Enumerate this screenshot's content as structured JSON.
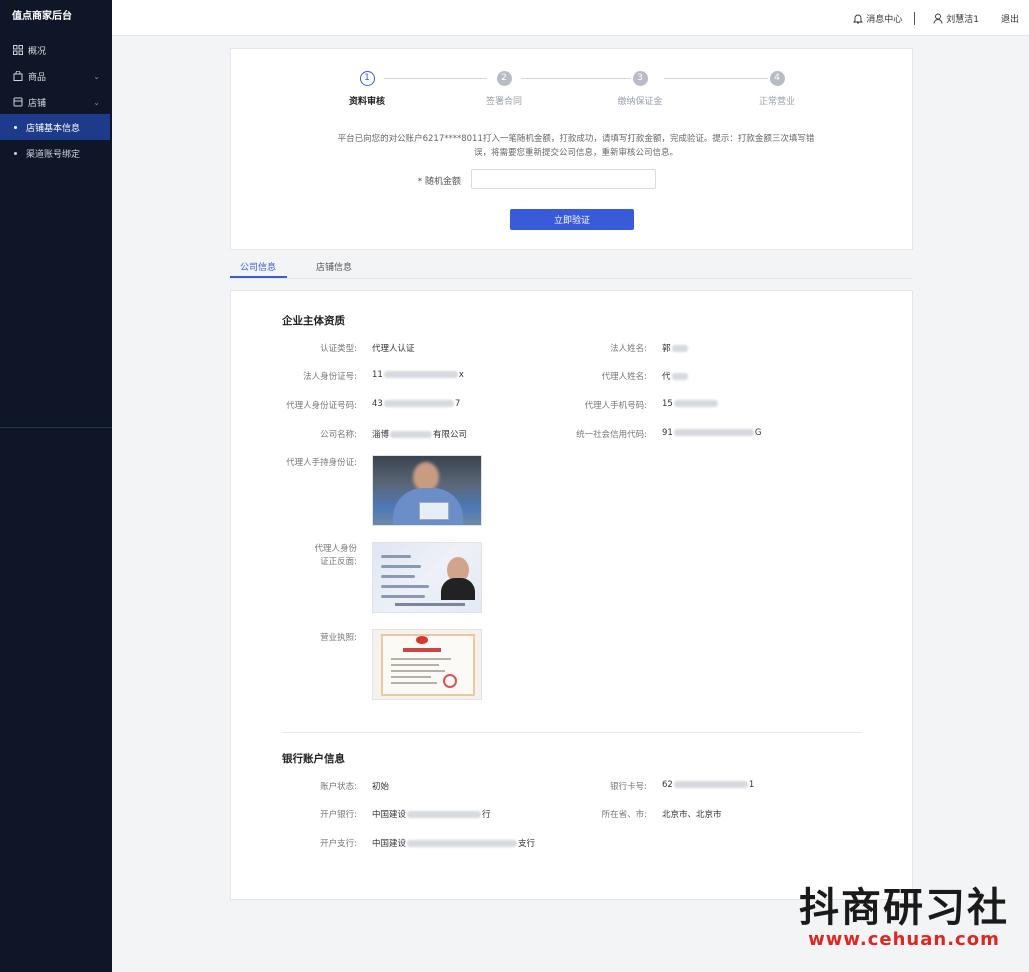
{
  "sidebar": {
    "brand": "值点商家后台",
    "items": [
      {
        "label": "概况",
        "icon": "dashboard-icon"
      },
      {
        "label": "商品",
        "icon": "bag-icon"
      },
      {
        "label": "店铺",
        "icon": "store-icon"
      }
    ],
    "sub_items": [
      {
        "label": "店铺基本信息",
        "active": true
      },
      {
        "label": "渠道账号绑定",
        "active": false
      }
    ]
  },
  "header": {
    "messages": "消息中心",
    "user": "刘慧洁1",
    "logout": "退出"
  },
  "steps": [
    {
      "num": "1",
      "label": "资料审核",
      "active": true
    },
    {
      "num": "2",
      "label": "签署合同",
      "active": false
    },
    {
      "num": "3",
      "label": "缴纳保证金",
      "active": false
    },
    {
      "num": "4",
      "label": "正常营业",
      "active": false
    }
  ],
  "verify": {
    "notice": "平台已向您的对公账户6217****8011打入一笔随机金额，打款成功，请填写打款金额，完成验证。提示：打款金额三次填写错误，将需要您重新提交公司信息，重新审核公司信息。",
    "amount_label": "* 随机金额",
    "amount_value": "",
    "button": "立即验证"
  },
  "tabs": [
    "公司信息",
    "店铺信息"
  ],
  "company": {
    "title": "企业主体资质",
    "fields": {
      "cert_type_label": "认证类型:",
      "cert_type_value": "代理人认证",
      "legal_name_label": "法人姓名:",
      "legal_name_prefix": "郭",
      "legal_id_label": "法人身份证号:",
      "legal_id_prefix": "11",
      "legal_id_suffix": "x",
      "agent_name_label": "代理人姓名:",
      "agent_name_prefix": "代",
      "agent_id_label": "代理人身份证号码:",
      "agent_id_prefix": "43",
      "agent_id_suffix": "7",
      "agent_phone_label": "代理人手机号码:",
      "agent_phone_prefix": "15",
      "company_name_label": "公司名称:",
      "company_name_prefix": "淄博",
      "company_name_suffix": "有限公司",
      "credit_code_label": "统一社会信用代码:",
      "credit_code_prefix": "91",
      "credit_code_suffix": "G",
      "agent_hold_id_label": "代理人手持身份证:",
      "agent_id_front_back_label": "代理人身份证正反面:",
      "license_label": "营业执照:"
    }
  },
  "bank": {
    "title": "银行账户信息",
    "fields": {
      "status_label": "账户状态:",
      "status_value": "初始",
      "card_label": "银行卡号:",
      "card_prefix": "62",
      "card_suffix": "1",
      "bank_label": "开户银行:",
      "bank_prefix": "中国建设",
      "bank_suffix": "行",
      "region_label": "所在省、市:",
      "region_value": "北京市、北京市",
      "branch_label": "开户支行:",
      "branch_prefix": "中国建设",
      "branch_suffix": "支行"
    }
  },
  "watermark": {
    "big": "抖商研习社",
    "small": "www.cehuan.com"
  },
  "colors": {
    "primary": "#3a5bd9",
    "sidebar_bg": "#0f1627",
    "active_item_bg": "#1e3a8a"
  }
}
